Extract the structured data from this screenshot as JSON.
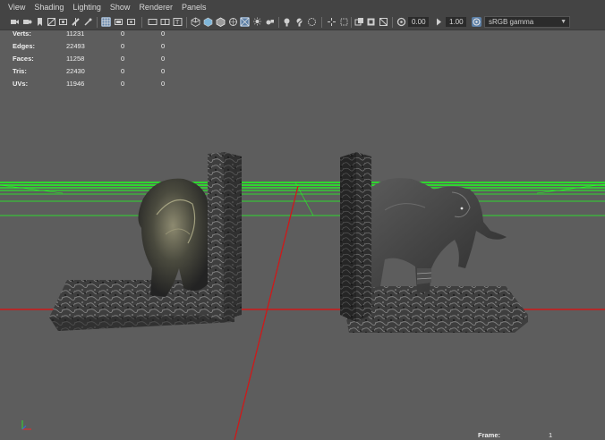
{
  "menubar": {
    "items": [
      {
        "label": "View"
      },
      {
        "label": "Shading"
      },
      {
        "label": "Lighting"
      },
      {
        "label": "Show"
      },
      {
        "label": "Renderer"
      },
      {
        "label": "Panels"
      }
    ]
  },
  "toolbar": {
    "exposure_value": "0.00",
    "gamma_value": "1.00",
    "color_space": "sRGB gamma",
    "icons": [
      "camera-icon",
      "camera-attributes-icon",
      "bookmark-icon",
      "image-plane-icon",
      "2d-pan-icon",
      "grease-pencil-icon",
      "grid-icon",
      "film-gate-icon",
      "resolution-gate-icon",
      "gate-mask-icon",
      "field-chart-icon",
      "safe-action-icon",
      "safe-title-icon",
      "wireframe-icon",
      "smooth-shade-icon",
      "wireframe-on-shaded-icon",
      "xray-icon",
      "use-default-material-icon",
      "shadows-icon",
      "screen-space-ao-icon",
      "motion-blur-icon",
      "anti-aliasing-icon",
      "depth-of-field-icon",
      "isolate-select-icon",
      "xray-joints-icon",
      "xray-active-icon",
      "exposure-icon",
      "gamma-icon",
      "color-management-icon"
    ]
  },
  "hud": {
    "rows": [
      {
        "label": "Verts:",
        "v1": "11231",
        "v2": "0",
        "v3": "0"
      },
      {
        "label": "Edges:",
        "v1": "22493",
        "v2": "0",
        "v3": "0"
      },
      {
        "label": "Faces:",
        "v1": "11258",
        "v2": "0",
        "v3": "0"
      },
      {
        "label": "Tris:",
        "v1": "22430",
        "v2": "0",
        "v3": "0"
      },
      {
        "label": "UVs:",
        "v1": "11946",
        "v2": "0",
        "v3": "0"
      }
    ],
    "frame_label": "Frame:",
    "frame_value": "1"
  },
  "colors": {
    "viewport_bg": "#5d5d5d",
    "ui_bg": "#444444",
    "grid_green": "#22ff22",
    "axis_red": "#d01818",
    "highlight_blue": "#5c7fa6"
  }
}
